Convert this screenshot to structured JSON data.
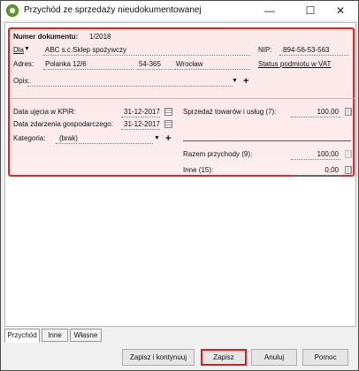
{
  "window": {
    "title": "Przychód ze sprzedaży nieudokumentowanej",
    "minimize": "—",
    "maximize": "☐",
    "close": "✕"
  },
  "doc": {
    "number_label": "Numer dokumentu:",
    "number_value": "1/2018",
    "for_label": "Dla",
    "for_value": "ABC s.c.Sklep spożywczy",
    "nip_label": "NIP:",
    "nip_value": "894-56-53-563",
    "address_label": "Adres:",
    "street": "Polanka 12/6",
    "postcode": "54-365",
    "city": "Wrocław",
    "vat_status_link": "Status podmiotu w VAT",
    "desc_label": "Opis:",
    "desc_value": ""
  },
  "dates": {
    "kpir_label": "Data ujęcia w KPiR:",
    "kpir_value": "31-12-2017",
    "event_label": "Data zdarzenia gospodarczego:",
    "event_value": "31-12-2017",
    "category_label": "Kategoria:",
    "category_value": "(brak)"
  },
  "amounts": {
    "sales_label": "Sprzedaż towarów i usług (7):",
    "sales_value": "100,00",
    "total_label": "Razem przychody (9):",
    "total_value": "100,00",
    "other_label": "Inne (15):",
    "other_value": "0,00"
  },
  "tabs": [
    "Przychód",
    "Inne",
    "Własne"
  ],
  "buttons": {
    "save_continue": "Zapisz i kontynuuj",
    "save": "Zapisz",
    "cancel": "Anuluj",
    "help": "Pomoc"
  }
}
